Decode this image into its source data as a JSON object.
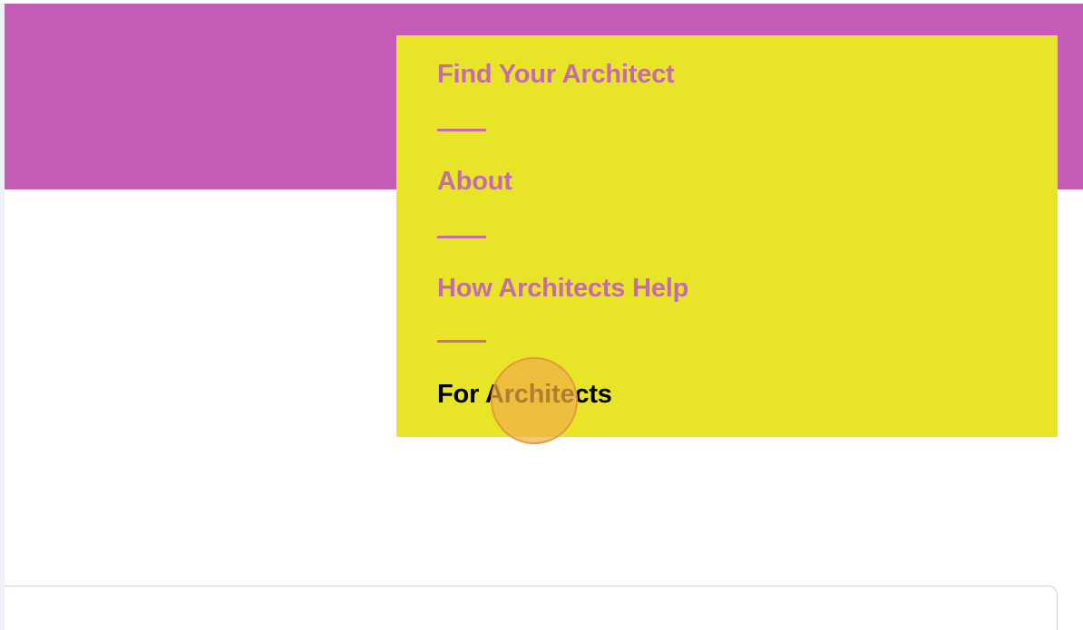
{
  "colors": {
    "header_band": "#c55cb7",
    "dropdown_background": "#e8e428",
    "menu_link": "#c56bb0",
    "menu_link_active": "#000000",
    "cursor_highlight": "#f0b046"
  },
  "nav_menu": {
    "items": [
      {
        "label": "Find Your Architect",
        "state": "default"
      },
      {
        "label": "About",
        "state": "default"
      },
      {
        "label": "How Architects Help",
        "state": "default"
      },
      {
        "label": "For Architects",
        "state": "hover"
      }
    ]
  }
}
